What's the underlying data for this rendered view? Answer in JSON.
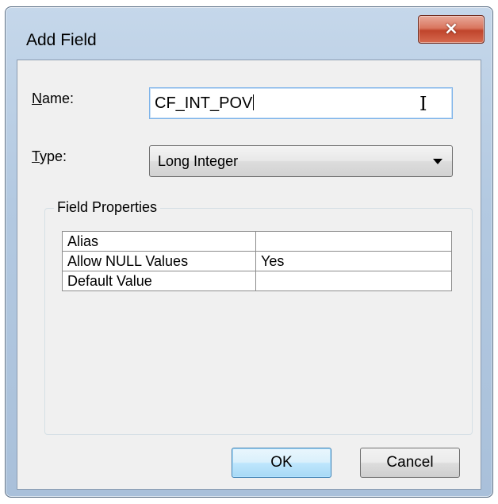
{
  "window": {
    "title": "Add Field",
    "close_icon": "×"
  },
  "form": {
    "name_label_accel": "N",
    "name_label_rest": "ame:",
    "name_value": "CF_INT_POV",
    "type_label_accel": "T",
    "type_label_rest": "ype:",
    "type_value": "Long Integer"
  },
  "field_properties": {
    "title": "Field Properties",
    "rows": [
      {
        "key": "Alias",
        "value": ""
      },
      {
        "key": "Allow NULL Values",
        "value": "Yes"
      },
      {
        "key": "Default Value",
        "value": ""
      }
    ]
  },
  "buttons": {
    "ok_label": "OK",
    "cancel_label": "Cancel"
  },
  "icons": {
    "close": "close-icon",
    "dropdown": "chevron-down-icon",
    "cursor": "text-cursor-icon"
  }
}
